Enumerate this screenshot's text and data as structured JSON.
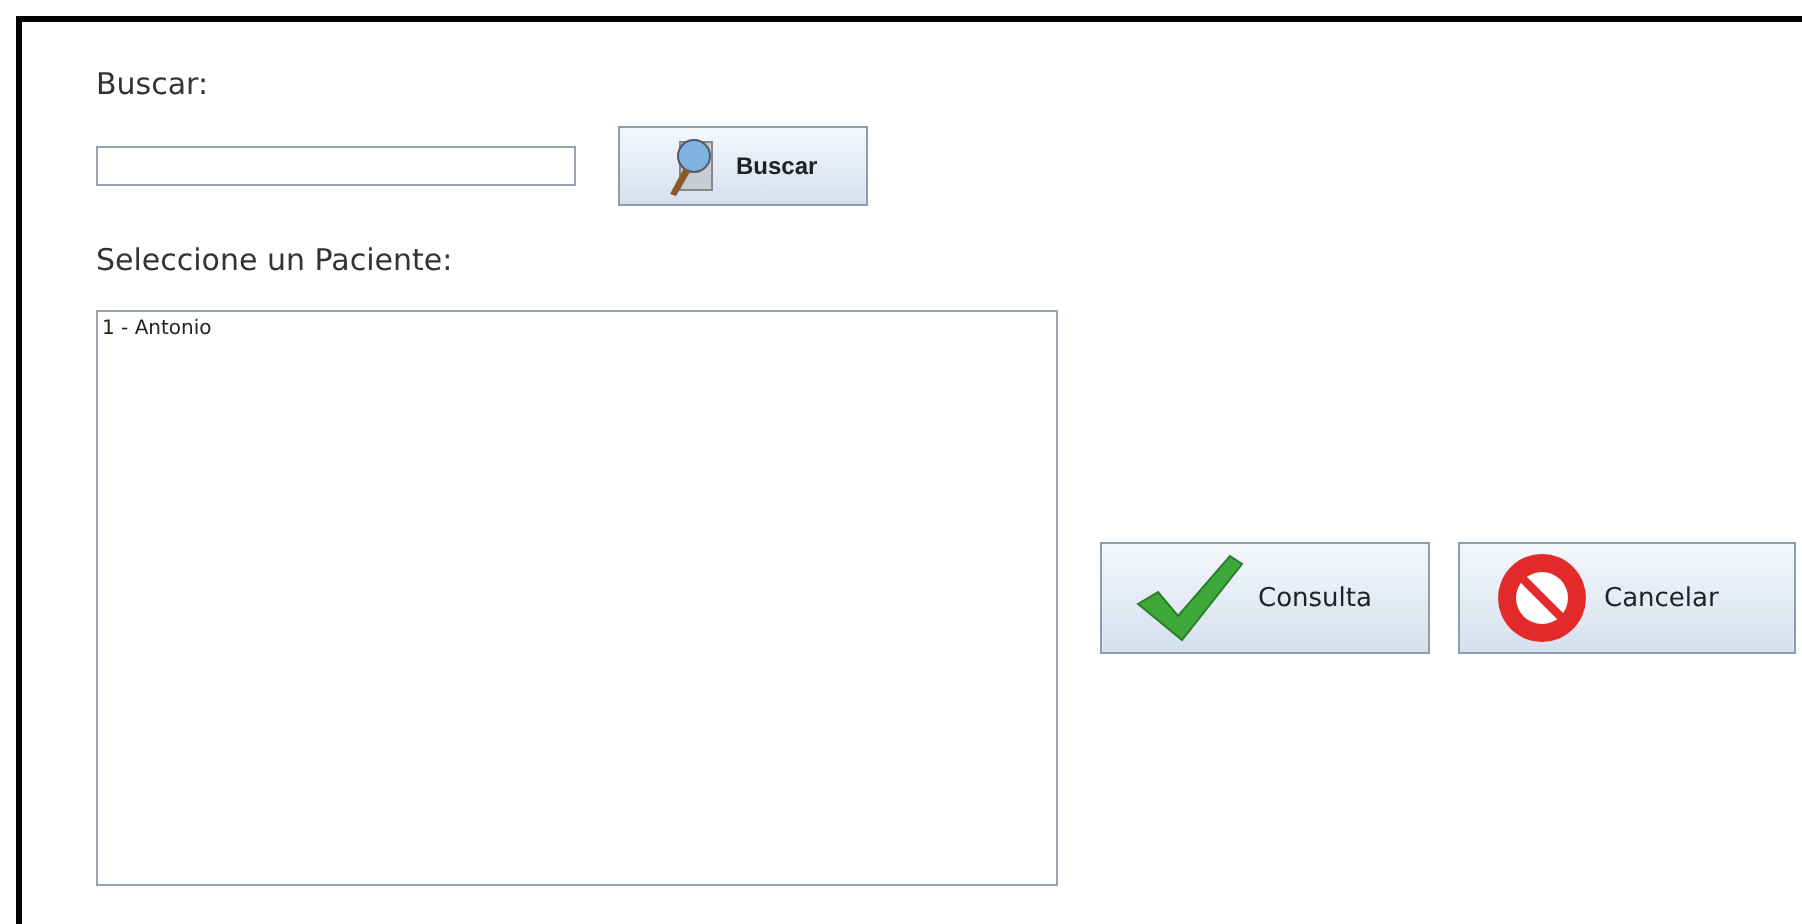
{
  "search": {
    "label": "Buscar:",
    "button": "Buscar"
  },
  "patients": {
    "label": "Seleccione un Paciente:",
    "items": [
      {
        "text": "1 - Antonio",
        "selected": false
      }
    ]
  },
  "actions": [
    {
      "kind": "confirm",
      "label": "Consulta"
    },
    {
      "kind": "cancel",
      "label": "Cancelar"
    }
  ]
}
